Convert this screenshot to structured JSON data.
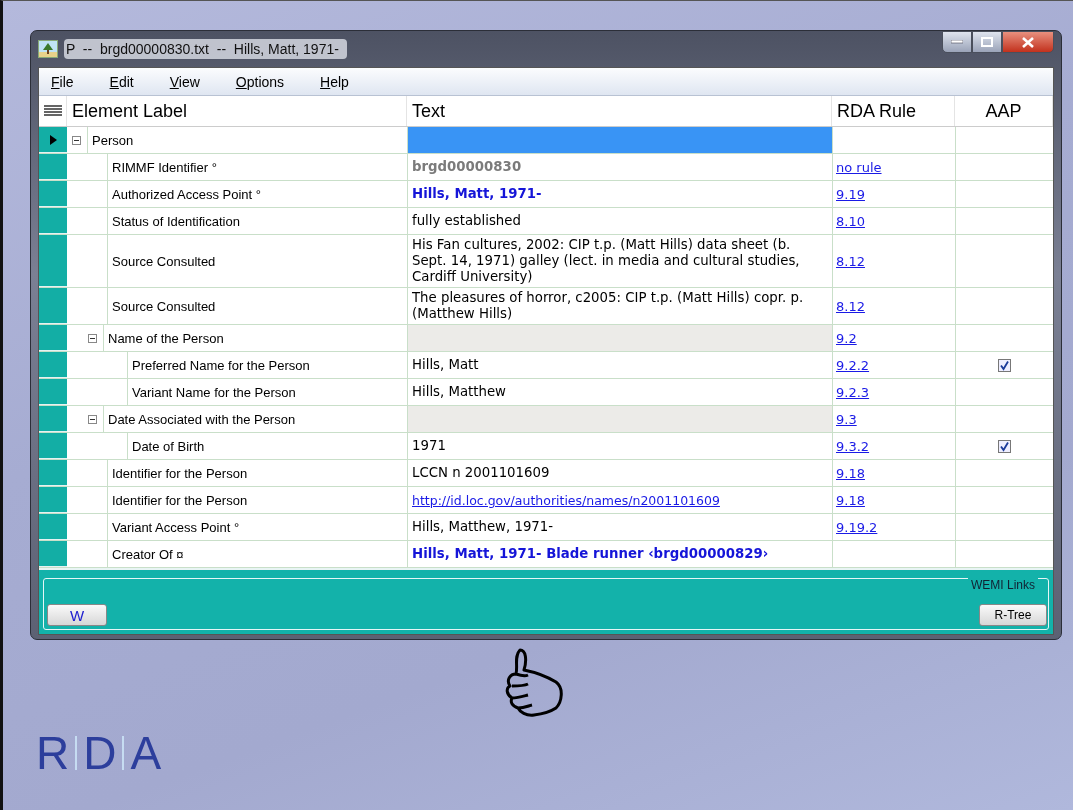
{
  "window": {
    "title": "P  --  brgd00000830.txt  --  Hills, Matt, 1971-",
    "menu": [
      "File",
      "Edit",
      "View",
      "Options",
      "Help"
    ],
    "columns": [
      "Element Label",
      "Text",
      "RDA Rule",
      "AAP"
    ],
    "tree": [
      {
        "label": "Person",
        "kind": "group",
        "selected": true,
        "expanded": true,
        "children": [
          {
            "label": "RIMMF Identifier °",
            "kind": "muted",
            "selected": false,
            "value": "brgd00000830",
            "rule": "no rule",
            "aap_checked": false
          },
          {
            "label": "Authorized Access Point °",
            "kind": "bold",
            "selected": false,
            "value": "Hills, Matt, 1971-",
            "rule": "9.19",
            "aap_checked": false
          },
          {
            "label": "Status of Identification",
            "kind": "plain",
            "selected": false,
            "value": "fully established",
            "rule": "8.10",
            "aap_checked": false
          },
          {
            "label": "Source Consulted",
            "kind": "plain",
            "selected": false,
            "value": "His Fan cultures, 2002: CIP t.p. (Matt Hills) data sheet (b. Sept. 14, 1971) galley (lect. in media and cultural studies, Cardiff University)",
            "rule": "8.12",
            "aap_checked": false
          },
          {
            "label": "Source Consulted",
            "kind": "plain",
            "selected": false,
            "value": "The pleasures of horror, c2005: CIP t.p. (Matt Hills) copr. p. (Matthew Hills)",
            "rule": "8.12",
            "aap_checked": false
          },
          {
            "label": "Name of the Person",
            "kind": "group",
            "selected": false,
            "expanded": true,
            "rule": "9.2",
            "children": [
              {
                "label": "Preferred Name for the Person",
                "kind": "plain",
                "selected": false,
                "value": "Hills, Matt",
                "rule": "9.2.2",
                "aap_checked": true
              },
              {
                "label": "Variant Name for the Person",
                "kind": "plain",
                "selected": false,
                "value": "Hills, Matthew",
                "rule": "9.2.3",
                "aap_checked": false
              }
            ]
          },
          {
            "label": "Date Associated with the Person",
            "kind": "group",
            "selected": false,
            "expanded": true,
            "rule": "9.3",
            "children": [
              {
                "label": "Date of Birth",
                "kind": "plain",
                "selected": false,
                "value": "1971",
                "rule": "9.3.2",
                "aap_checked": true
              }
            ]
          },
          {
            "label": "Identifier for the Person",
            "kind": "plain",
            "selected": false,
            "value": "LCCN n 2001101609",
            "rule": "9.18",
            "aap_checked": false
          },
          {
            "label": "Identifier for the Person",
            "kind": "link",
            "selected": false,
            "value": "http://id.loc.gov/authorities/names/n2001101609",
            "rule": "9.18",
            "aap_checked": false
          },
          {
            "label": "Variant Access Point °",
            "kind": "plain",
            "selected": false,
            "value": "Hills, Matthew, 1971-",
            "rule": "9.19.2",
            "aap_checked": false
          },
          {
            "label": "Creator Of ¤",
            "kind": "bold",
            "selected": false,
            "value": "Hills, Matt, 1971- Blade runner ‹brgd00000829›",
            "aap_checked": false
          }
        ]
      }
    ],
    "footer": {
      "group_label": "WEMI Links",
      "buttons": [
        "W",
        "R-Tree"
      ]
    }
  },
  "logo": [
    "R",
    "D",
    "A"
  ]
}
